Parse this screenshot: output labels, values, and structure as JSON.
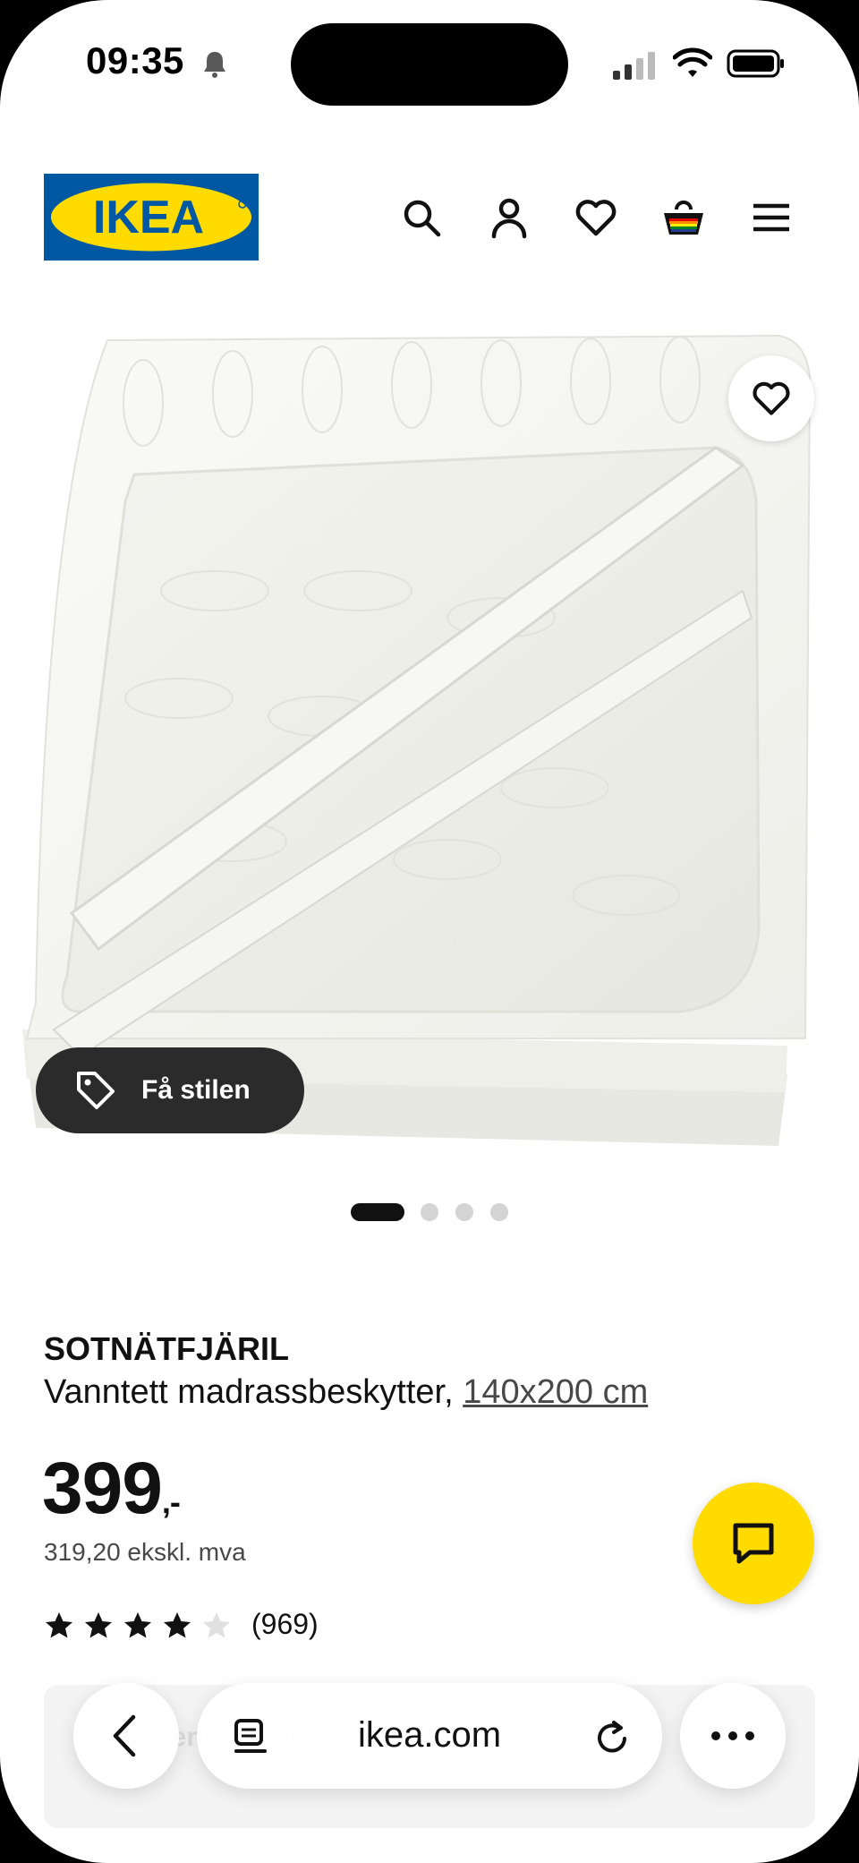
{
  "status_bar": {
    "time": "09:35"
  },
  "header": {
    "logo_text": "IKEA",
    "icons": [
      "search-icon",
      "account-icon",
      "favourites-icon",
      "basket-icon",
      "menu-icon"
    ]
  },
  "gallery": {
    "style_button_label": "Få stilen",
    "page_count": 4,
    "current_page": 1
  },
  "product": {
    "name": "SOTNÄTFJÄRIL",
    "description": "Vanntett madrassbeskytter,",
    "size": "140x200 cm",
    "price": "399",
    "price_suffix": ",-",
    "price_ex_vat": "319,20 ekskl. mva",
    "rating": 4,
    "rating_max": 5,
    "review_count": "(969)"
  },
  "under_bar_text": "Hent i varehus",
  "browser": {
    "url": "ikea.com"
  },
  "colors": {
    "ikea_blue": "#0058a3",
    "ikea_yellow": "#ffdb00",
    "chip_bg": "#2b2b2b"
  }
}
